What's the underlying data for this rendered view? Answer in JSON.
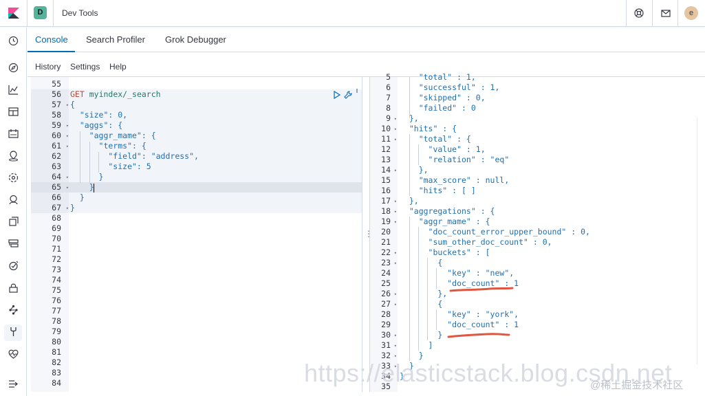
{
  "header": {
    "app_badge": "D",
    "title": "Dev Tools",
    "avatar_letter": "e"
  },
  "tabs": [
    {
      "label": "Console",
      "active": true
    },
    {
      "label": "Search Profiler",
      "active": false
    },
    {
      "label": "Grok Debugger",
      "active": false
    }
  ],
  "subnav": {
    "history": "History",
    "settings": "Settings",
    "help": "Help"
  },
  "left_nav_icons": [
    "recent-icon",
    "discover-icon",
    "visualize-icon",
    "dashboard-icon",
    "canvas-icon",
    "maps-icon",
    "ml-icon",
    "apm-icon",
    "uptime-icon",
    "siem-icon",
    "logs-icon",
    "security-icon",
    "graph-icon",
    "dev-tools-icon",
    "monitoring-icon",
    "collapse-icon"
  ],
  "request_editor": {
    "line_numbers": [
      "55",
      "56",
      "57",
      "58",
      "59",
      "60",
      "61",
      "62",
      "63",
      "64",
      "65",
      "66",
      "67",
      "68",
      "69",
      "70",
      "71",
      "72",
      "73",
      "74",
      "75",
      "76",
      "77",
      "78",
      "79",
      "80",
      "81",
      "82",
      "83",
      "84"
    ],
    "method": "GET",
    "endpoint": "myindex/_search",
    "body_lines": [
      "{",
      "  \"size\": 0,",
      "  \"aggs\": {",
      "    \"aggr_mame\": {",
      "      \"terms\": {",
      "        \"field\": \"address\",",
      "        \"size\": 5",
      "      }",
      "    }",
      "  }",
      "}"
    ]
  },
  "response_editor": {
    "line_numbers": [
      "5",
      "6",
      "7",
      "8",
      "9",
      "10",
      "11",
      "12",
      "13",
      "14",
      "15",
      "16",
      "17",
      "18",
      "19",
      "20",
      "21",
      "22",
      "23",
      "24",
      "25",
      "26",
      "27",
      "28",
      "29",
      "30",
      "31",
      "32",
      "33",
      "34",
      "35"
    ],
    "lines": [
      "    \"total\" : 1,",
      "    \"successful\" : 1,",
      "    \"skipped\" : 0,",
      "    \"failed\" : 0",
      "  },",
      "  \"hits\" : {",
      "    \"total\" : {",
      "      \"value\" : 1,",
      "      \"relation\" : \"eq\"",
      "    },",
      "    \"max_score\" : null,",
      "    \"hits\" : [ ]",
      "  },",
      "  \"aggregations\" : {",
      "    \"aggr_mame\" : {",
      "      \"doc_count_error_upper_bound\" : 0,",
      "      \"sum_other_doc_count\" : 0,",
      "      \"buckets\" : [",
      "        {",
      "          \"key\" : \"new\",",
      "          \"doc_count\" : 1",
      "        },",
      "        {",
      "          \"key\" : \"york\",",
      "          \"doc_count\" : 1",
      "        }",
      "      ]",
      "    }",
      "  }",
      "}",
      ""
    ]
  },
  "watermark": "https://elasticstack.blog.csdn.net",
  "watermark_credit": "@稀土掘金技术社区"
}
